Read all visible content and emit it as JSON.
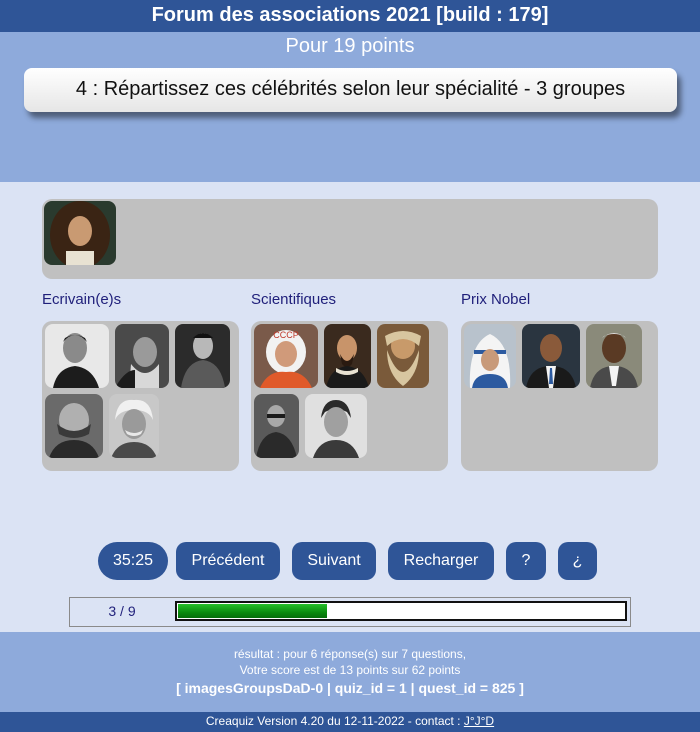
{
  "app": {
    "title": "Forum des associations 2021 [build : 179]"
  },
  "question": {
    "points": "Pour 19 points",
    "text": "4 : Répartissez ces célébrités selon leur spécialité - 3 groupes"
  },
  "groups": [
    {
      "title": "Ecrivain(e)s"
    },
    {
      "title": "Scientifiques"
    },
    {
      "title": "Prix Nobel"
    }
  ],
  "controls": {
    "timer": "35:25",
    "previous": "Précédent",
    "next": "Suivant",
    "reload": "Recharger",
    "help": "?",
    "inverse_help": "¿"
  },
  "progress": {
    "label": "3 / 9",
    "current": 3,
    "total": 9
  },
  "result": {
    "line1": "résultat : pour 6 réponse(s) sur 7 questions,",
    "line2": "Votre score est de 13 points sur 62 points",
    "info": "[ imagesGroupsDaD-0 | quiz_id = 1 | quest_id = 825 ]"
  },
  "footer": {
    "version": "Creaquiz Version 4.20 du 12-11-2022 - contact : ",
    "contact": "J°J°D"
  },
  "colors": {
    "dark_blue": "#2f5597",
    "header_blue": "#8eaadb",
    "background": "#dbe3f4",
    "box_grey": "#c0c0c0",
    "progress_green": "#0a8a0e"
  }
}
